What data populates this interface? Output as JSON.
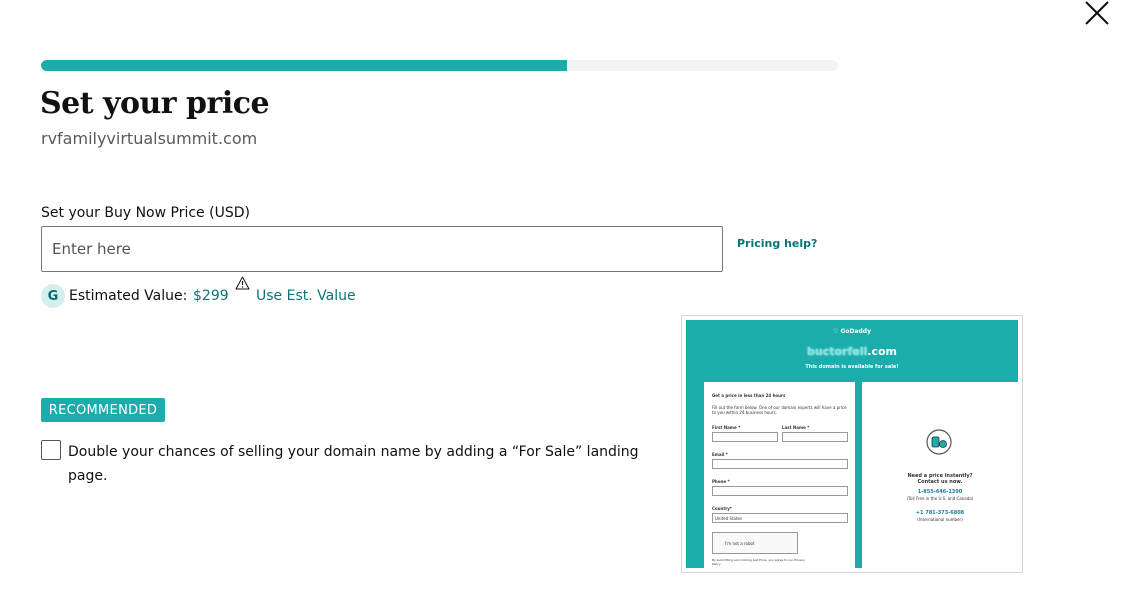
{
  "dialog": {
    "close_label": "×"
  },
  "progress": {
    "fraction": 0.66,
    "color": "#1bacac"
  },
  "header": {
    "title": "Set your price",
    "domain": "rvfamilyvirtualsummit.com"
  },
  "price": {
    "label": "Set your Buy Now Price (USD)",
    "placeholder": "Enter here",
    "value": "",
    "help_link": "Pricing help?"
  },
  "estimate": {
    "badge": "G",
    "label": "Estimated Value:",
    "value": "$299",
    "warning_icon": "warning-triangle-icon",
    "use_link": "Use Est. Value"
  },
  "landing_page": {
    "badge": "RECOMMENDED",
    "checkbox_checked": false,
    "checkbox_label": "Double your chances of selling your domain name by adding a “For Sale” landing page.",
    "preview": {
      "logo": "GoDaddy",
      "domain_suffix": ".com",
      "subtitle": "This domain is available for sale!",
      "form_title": "Get a price in less than 24 hours",
      "form_intro": "Fill out the form below. One of our domain experts will have a price to you within 24 business hours.",
      "first_name": "First Name *",
      "last_name": "Last Name *",
      "email": "Email *",
      "phone": "Phone *",
      "country": "Country*",
      "country_value": "United States",
      "captcha": "I'm not a robot",
      "consent": "By submitting and clicking Get Price, you agree to our Privacy Policy",
      "need_price": "Need a price instantly?",
      "contact_us": "Contact us now.",
      "phone_us": "1-855-646-1390",
      "toll_free": "(Toll Free in the U.S. and Canada)",
      "phone_intl": "+1 781-373-6808",
      "intl": "(International number)"
    }
  },
  "colors": {
    "accent": "#1bacac",
    "link": "#09757a"
  }
}
